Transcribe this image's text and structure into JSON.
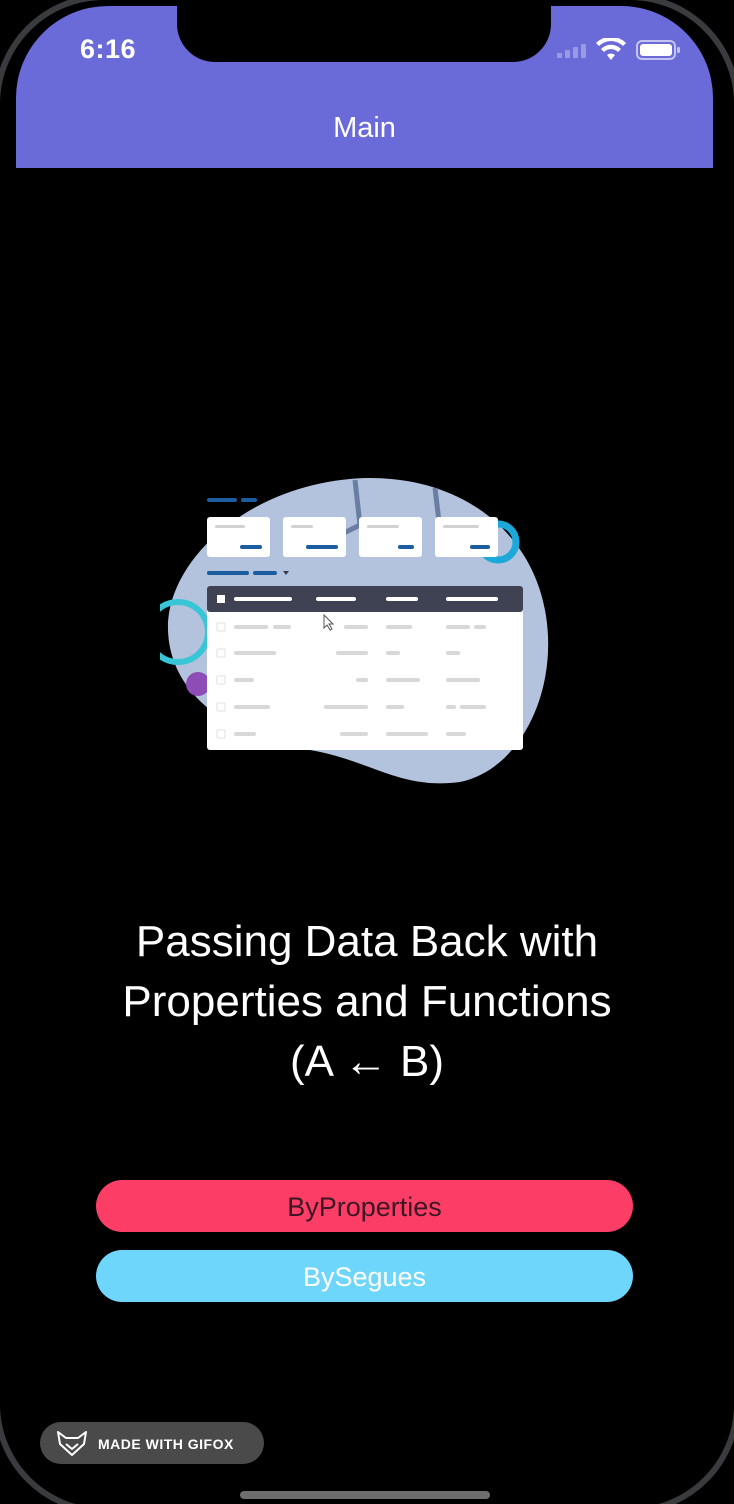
{
  "status_bar": {
    "time": "6:16",
    "signal_icon": "cellular-signal-icon",
    "wifi_icon": "wifi-icon",
    "battery_icon": "battery-icon"
  },
  "nav": {
    "title": "Main",
    "background": "#6b6ad9"
  },
  "illustration": {
    "icon": "data-table-illustration"
  },
  "headline": {
    "line1": "Passing Data Back with",
    "line2": "Properties and Functions",
    "line3": "(A ← B)"
  },
  "buttons": {
    "by_properties": {
      "label": "ByProperties",
      "color": "#fc3e67"
    },
    "by_segues": {
      "label": "BySegues",
      "color": "#6fd6fb"
    }
  },
  "watermark": {
    "label": "MADE WITH GIFOX",
    "icon": "fox-logo-icon"
  }
}
